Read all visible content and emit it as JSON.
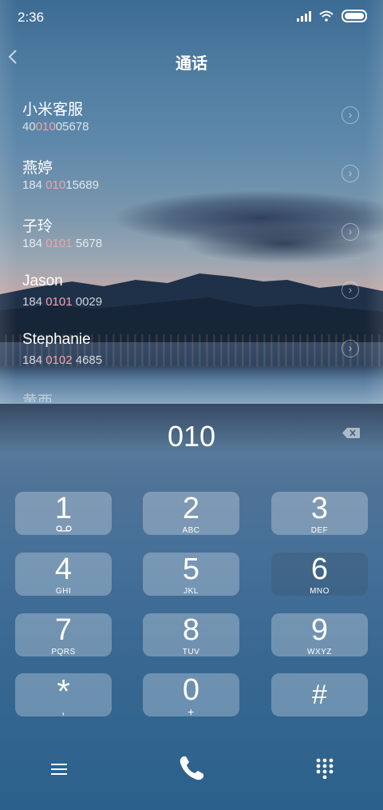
{
  "status": {
    "time": "2:36"
  },
  "header": {
    "title": "通话",
    "back_icon": "chevron-left-icon"
  },
  "contacts": [
    {
      "name": "小米客服",
      "num_pre": "40",
      "num_hl": "010",
      "num_post": "05678"
    },
    {
      "name": "燕婷",
      "num_pre": "184 ",
      "num_hl": "010",
      "num_post": "15689"
    },
    {
      "name": "子玲",
      "num_pre": "184 ",
      "num_hl": "0101",
      "num_post": " 5678"
    },
    {
      "name": "Jason",
      "num_pre": "184 ",
      "num_hl": "0101",
      "num_post": " 0029"
    },
    {
      "name": "Stephanie",
      "num_pre": "184 ",
      "num_hl": "0102",
      "num_post": " 4685"
    },
    {
      "name": "黄西",
      "num_pre": "",
      "num_hl": "",
      "num_post": ""
    }
  ],
  "dialer": {
    "input": "010",
    "keys": [
      {
        "digit": "1",
        "letters": ""
      },
      {
        "digit": "2",
        "letters": "ABC"
      },
      {
        "digit": "3",
        "letters": "DEF"
      },
      {
        "digit": "4",
        "letters": "GHI"
      },
      {
        "digit": "5",
        "letters": "JKL"
      },
      {
        "digit": "6",
        "letters": "MNO"
      },
      {
        "digit": "7",
        "letters": "PQRS"
      },
      {
        "digit": "8",
        "letters": "TUV"
      },
      {
        "digit": "9",
        "letters": "WXYZ"
      },
      {
        "digit": "*",
        "letters": ","
      },
      {
        "digit": "0",
        "letters": "+"
      },
      {
        "digit": "#",
        "letters": ""
      }
    ]
  },
  "colors": {
    "highlight": "#f2a2a9",
    "background": "#2d5f86"
  }
}
